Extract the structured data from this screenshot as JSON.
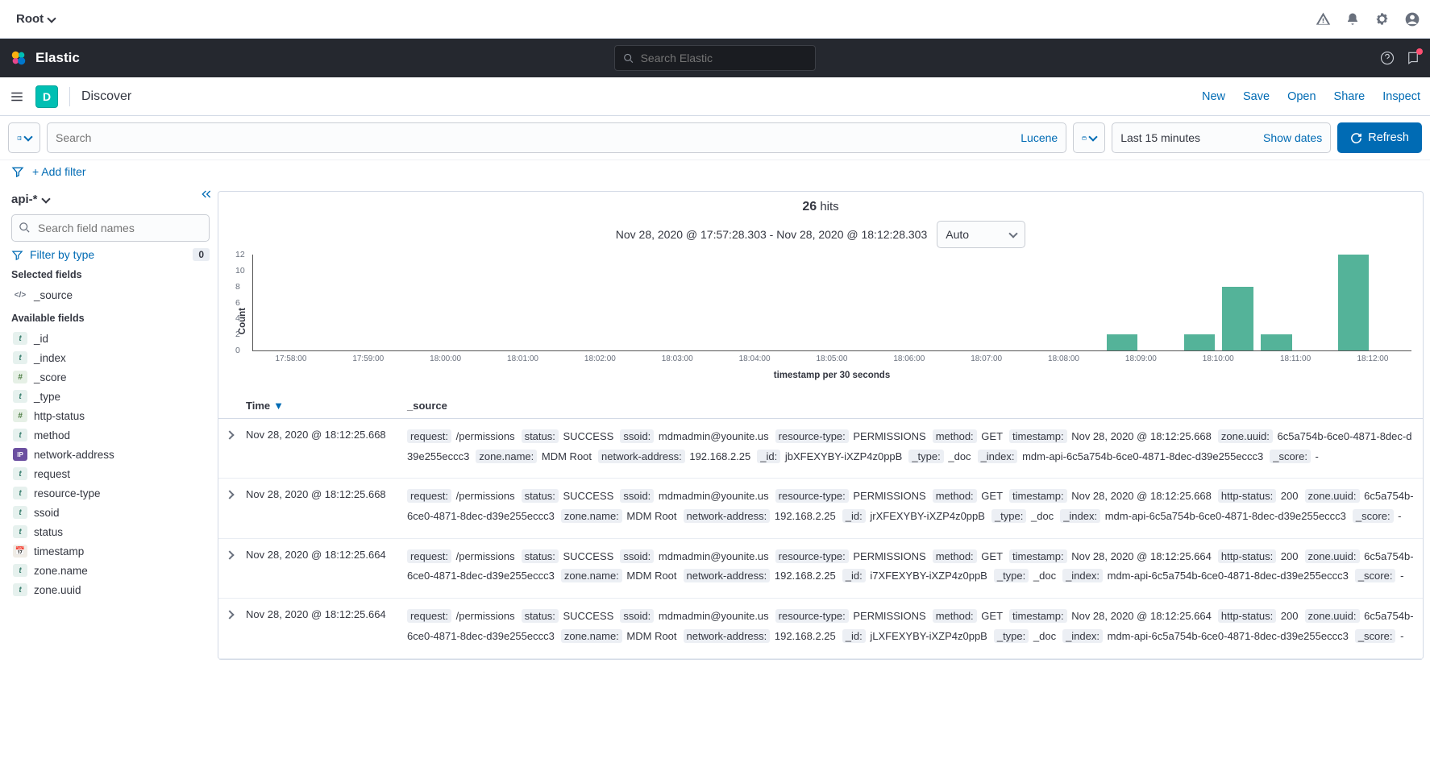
{
  "rootbar": {
    "label": "Root"
  },
  "eheader": {
    "brand": "Elastic",
    "search_placeholder": "Search Elastic"
  },
  "subheader": {
    "badge": "D",
    "title": "Discover",
    "actions": [
      "New",
      "Save",
      "Open",
      "Share",
      "Inspect"
    ]
  },
  "searchrow": {
    "query_placeholder": "Search",
    "lang": "Lucene",
    "timerange": "Last 15 minutes",
    "showdates": "Show dates",
    "refresh": "Refresh"
  },
  "filterrow": {
    "addfilter": "+ Add filter"
  },
  "sidebar": {
    "pattern": "api-*",
    "fieldsearch_placeholder": "Search field names",
    "filterbytype": "Filter by type",
    "filterbytype_count": "0",
    "selected_heading": "Selected fields",
    "selected": [
      {
        "t": "src",
        "glyph": "</>",
        "name": "_source"
      }
    ],
    "available_heading": "Available fields",
    "available": [
      {
        "t": "t",
        "glyph": "t",
        "name": "_id"
      },
      {
        "t": "t",
        "glyph": "t",
        "name": "_index"
      },
      {
        "t": "n",
        "glyph": "#",
        "name": "_score"
      },
      {
        "t": "t",
        "glyph": "t",
        "name": "_type"
      },
      {
        "t": "n",
        "glyph": "#",
        "name": "http-status"
      },
      {
        "t": "t",
        "glyph": "t",
        "name": "method"
      },
      {
        "t": "ip",
        "glyph": "IP",
        "name": "network-address"
      },
      {
        "t": "t",
        "glyph": "t",
        "name": "request"
      },
      {
        "t": "t",
        "glyph": "t",
        "name": "resource-type"
      },
      {
        "t": "t",
        "glyph": "t",
        "name": "ssoid"
      },
      {
        "t": "t",
        "glyph": "t",
        "name": "status"
      },
      {
        "t": "d",
        "glyph": "📅",
        "name": "timestamp"
      },
      {
        "t": "t",
        "glyph": "t",
        "name": "zone.name"
      },
      {
        "t": "t",
        "glyph": "t",
        "name": "zone.uuid"
      }
    ]
  },
  "hits": {
    "count": "26",
    "label": "hits"
  },
  "daterange": {
    "text": "Nov 28, 2020 @ 17:57:28.303 - Nov 28, 2020 @ 18:12:28.303",
    "auto": "Auto"
  },
  "chart_data": {
    "type": "bar",
    "ylabel": "Count",
    "xlabel": "timestamp per 30 seconds",
    "ylim": [
      0,
      12
    ],
    "yticks": [
      0,
      2,
      4,
      6,
      8,
      10,
      12
    ],
    "categories": [
      "17:58:00",
      "17:59:00",
      "18:00:00",
      "18:01:00",
      "18:02:00",
      "18:03:00",
      "18:04:00",
      "18:05:00",
      "18:06:00",
      "18:07:00",
      "18:08:00",
      "18:09:00",
      "18:10:00",
      "18:11:00",
      "18:12:00"
    ],
    "bars30s": [
      0,
      0,
      0,
      0,
      0,
      0,
      0,
      0,
      0,
      0,
      0,
      0,
      0,
      0,
      0,
      0,
      0,
      0,
      0,
      0,
      0,
      0,
      2,
      0,
      2,
      8,
      2,
      0,
      12,
      0
    ],
    "note": "values are per 30-second bucket; two bars per minute label"
  },
  "table": {
    "col_time": "Time",
    "col_source": "_source",
    "rows": [
      {
        "time": "Nov 28, 2020 @ 18:12:25.668",
        "kv": [
          [
            "request:",
            "/permissions"
          ],
          [
            "status:",
            "SUCCESS"
          ],
          [
            "ssoid:",
            "mdmadmin@younite.us"
          ],
          [
            "resource-type:",
            "PERMISSIONS"
          ],
          [
            "method:",
            "GET"
          ],
          [
            "timestamp:",
            "Nov 28, 2020 @ 18:12:25.668"
          ],
          [
            "zone.uuid:",
            "6c5a754b-6ce0-4871-8dec-d39e255eccc3"
          ],
          [
            "zone.name:",
            "MDM Root"
          ],
          [
            "network-address:",
            "192.168.2.25"
          ],
          [
            "_id:",
            "jbXFEXYBY-iXZP4z0ppB"
          ],
          [
            "_type:",
            "_doc"
          ],
          [
            "_index:",
            "mdm-api-6c5a754b-6ce0-4871-8dec-d39e255eccc3"
          ],
          [
            "_score:",
            "-"
          ]
        ]
      },
      {
        "time": "Nov 28, 2020 @ 18:12:25.668",
        "kv": [
          [
            "request:",
            "/permissions"
          ],
          [
            "status:",
            "SUCCESS"
          ],
          [
            "ssoid:",
            "mdmadmin@younite.us"
          ],
          [
            "resource-type:",
            "PERMISSIONS"
          ],
          [
            "method:",
            "GET"
          ],
          [
            "timestamp:",
            "Nov 28, 2020 @ 18:12:25.668"
          ],
          [
            "http-status:",
            "200"
          ],
          [
            "zone.uuid:",
            "6c5a754b-6ce0-4871-8dec-d39e255eccc3"
          ],
          [
            "zone.name:",
            "MDM Root"
          ],
          [
            "network-address:",
            "192.168.2.25"
          ],
          [
            "_id:",
            "jrXFEXYBY-iXZP4z0ppB"
          ],
          [
            "_type:",
            "_doc"
          ],
          [
            "_index:",
            "mdm-api-6c5a754b-6ce0-4871-8dec-d39e255eccc3"
          ],
          [
            "_score:",
            "-"
          ]
        ]
      },
      {
        "time": "Nov 28, 2020 @ 18:12:25.664",
        "kv": [
          [
            "request:",
            "/permissions"
          ],
          [
            "status:",
            "SUCCESS"
          ],
          [
            "ssoid:",
            "mdmadmin@younite.us"
          ],
          [
            "resource-type:",
            "PERMISSIONS"
          ],
          [
            "method:",
            "GET"
          ],
          [
            "timestamp:",
            "Nov 28, 2020 @ 18:12:25.664"
          ],
          [
            "http-status:",
            "200"
          ],
          [
            "zone.uuid:",
            "6c5a754b-6ce0-4871-8dec-d39e255eccc3"
          ],
          [
            "zone.name:",
            "MDM Root"
          ],
          [
            "network-address:",
            "192.168.2.25"
          ],
          [
            "_id:",
            "i7XFEXYBY-iXZP4z0ppB"
          ],
          [
            "_type:",
            "_doc"
          ],
          [
            "_index:",
            "mdm-api-6c5a754b-6ce0-4871-8dec-d39e255eccc3"
          ],
          [
            "_score:",
            "-"
          ]
        ]
      },
      {
        "time": "Nov 28, 2020 @ 18:12:25.664",
        "kv": [
          [
            "request:",
            "/permissions"
          ],
          [
            "status:",
            "SUCCESS"
          ],
          [
            "ssoid:",
            "mdmadmin@younite.us"
          ],
          [
            "resource-type:",
            "PERMISSIONS"
          ],
          [
            "method:",
            "GET"
          ],
          [
            "timestamp:",
            "Nov 28, 2020 @ 18:12:25.664"
          ],
          [
            "http-status:",
            "200"
          ],
          [
            "zone.uuid:",
            "6c5a754b-6ce0-4871-8dec-d39e255eccc3"
          ],
          [
            "zone.name:",
            "MDM Root"
          ],
          [
            "network-address:",
            "192.168.2.25"
          ],
          [
            "_id:",
            "jLXFEXYBY-iXZP4z0ppB"
          ],
          [
            "_type:",
            "_doc"
          ],
          [
            "_index:",
            "mdm-api-6c5a754b-6ce0-4871-8dec-d39e255eccc3"
          ],
          [
            "_score:",
            "-"
          ]
        ]
      }
    ]
  }
}
